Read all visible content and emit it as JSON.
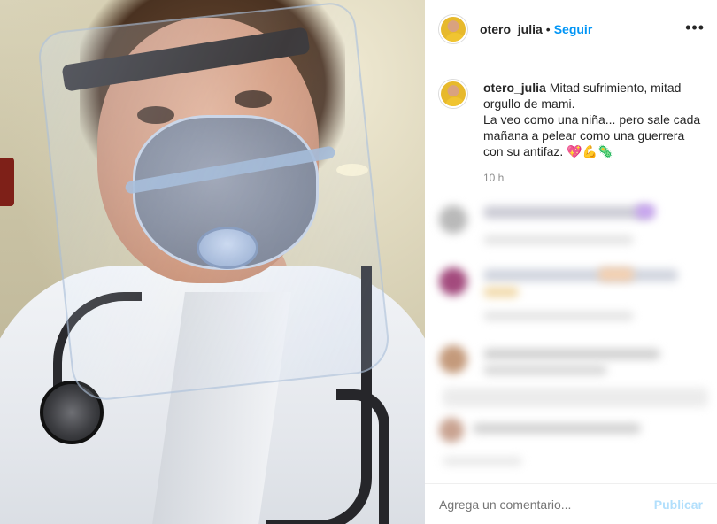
{
  "post": {
    "username": "otero_julia",
    "follow_label": "Seguir",
    "separator": "•",
    "more_label": "•••",
    "caption": {
      "username": "otero_julia",
      "line1": "Mitad sufrimiento, mitad orgullo de mami.",
      "line2": "La veo como una niña... pero sale cada mañana a pelear como una guerrera con su antifaz.",
      "emojis": "💖💪🦠"
    },
    "time_ago": "10 h"
  },
  "comment_box": {
    "placeholder": "Agrega un comentario...",
    "publish_label": "Publicar"
  },
  "colors": {
    "link_blue": "#0095f6",
    "publish_disabled": "#b2dffc",
    "secondary_text": "#8e8e8e"
  }
}
